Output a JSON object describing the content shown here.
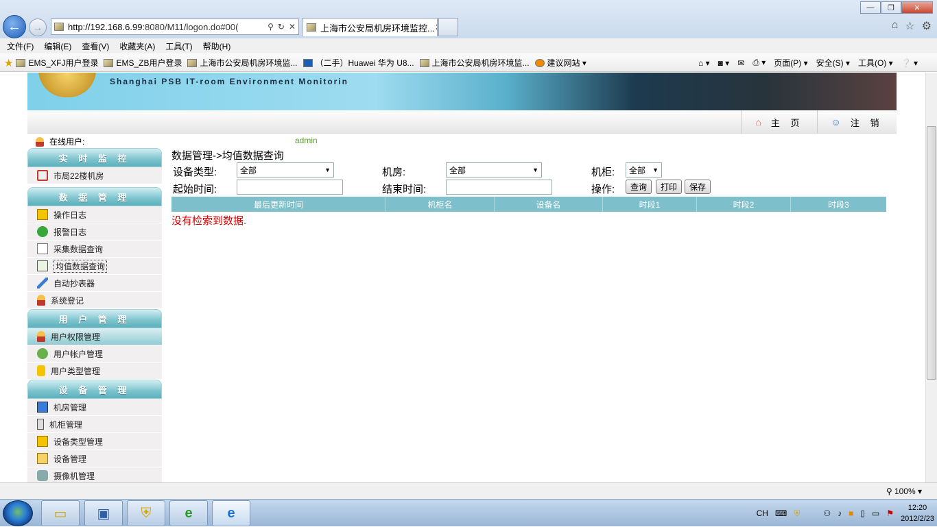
{
  "browser": {
    "url_prefix": "http://192.168.6.99",
    "url_rest": ":8080/M11/logon.do#00(",
    "tab_title": "上海市公安局机房环境监控...",
    "menu": [
      "文件(F)",
      "编辑(E)",
      "查看(V)",
      "收藏夹(A)",
      "工具(T)",
      "帮助(H)"
    ],
    "favorites": [
      "EMS_XFJ用户登录",
      "EMS_ZB用户登录",
      "上海市公安局机房环境监...",
      "（二手）Huawei 华为 U8...",
      "上海市公安局机房环境监...",
      "建议网站 ▾"
    ],
    "command_bar": [
      "页面(P) ▾",
      "安全(S) ▾",
      "工具(O) ▾"
    ],
    "zoom": "100%"
  },
  "header": {
    "subtitle": "Shanghai PSB IT-room Environment Monitorin",
    "home_label": "主 页",
    "logout_label": "注 销",
    "online_label": "在线用户:",
    "online_user": "admin"
  },
  "sidebar": {
    "sections": [
      {
        "title": "实 时 监 控",
        "items": [
          {
            "label": "市局22楼机房",
            "icon": "house-icon"
          }
        ]
      },
      {
        "title": "数 据 管 理",
        "items": [
          {
            "label": "操作日志",
            "icon": "notebook-icon"
          },
          {
            "label": "报警日志",
            "icon": "info-icon"
          },
          {
            "label": "采集数据查询",
            "icon": "edit-doc-icon"
          },
          {
            "label": "均值数据查询",
            "icon": "export-icon"
          },
          {
            "label": "自动抄表器",
            "icon": "pencil-icon"
          },
          {
            "label": "系统登记",
            "icon": "user-icon"
          }
        ]
      },
      {
        "title": "用 户 管 理",
        "items": [
          {
            "label": "用户权限管理",
            "icon": "user-icon"
          },
          {
            "label": "用户帐户管理",
            "icon": "users-icon"
          },
          {
            "label": "用户类型管理",
            "icon": "lock-icon"
          }
        ]
      },
      {
        "title": "设 备 管 理",
        "items": [
          {
            "label": "机房管理",
            "icon": "monitor-icon"
          },
          {
            "label": "机柜管理",
            "icon": "cabinet-icon"
          },
          {
            "label": "设备类型管理",
            "icon": "notebook-icon"
          },
          {
            "label": "设备管理",
            "icon": "add-doc-icon"
          },
          {
            "label": "摄像机管理",
            "icon": "camera-icon"
          }
        ]
      }
    ]
  },
  "main": {
    "breadcrumb": "数据管理->均值数据查询",
    "device_type_label": "设备类型:",
    "device_type_value": "全部",
    "room_label": "机房:",
    "room_value": "全部",
    "cabinet_label": "机柜:",
    "cabinet_value": "全部",
    "start_label": "起始时间:",
    "end_label": "结束时间:",
    "action_label": "操作:",
    "query_btn": "查询",
    "print_btn": "打印",
    "save_btn": "保存",
    "columns": [
      "最后更新时间",
      "机柜名",
      "设备名",
      "时段1",
      "时段2",
      "时段3"
    ],
    "no_data": "没有检索到数据."
  },
  "taskbar": {
    "ime": "CH",
    "time": "12:20",
    "date": "2012/2/23"
  }
}
